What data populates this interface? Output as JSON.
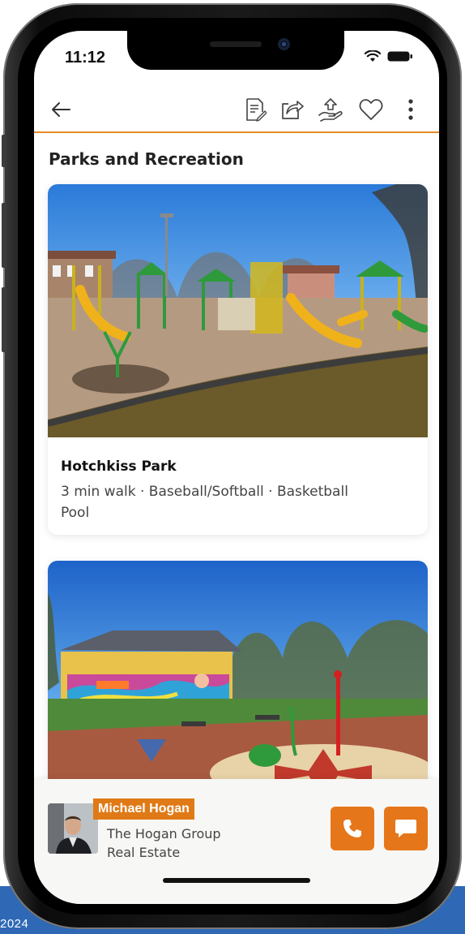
{
  "status_bar": {
    "time": "11:12"
  },
  "header": {
    "back_icon": "arrow-left-icon",
    "actions": [
      "document-edit-icon",
      "share-icon",
      "hand-offer-icon",
      "heart-icon",
      "more-vertical-icon"
    ]
  },
  "section": {
    "title": "Parks and Recreation"
  },
  "cards": [
    {
      "name": "Hotchkiss Park",
      "meta_line1": "3 min walk · Baseball/Softball · Basketball",
      "meta_line2": "Pool",
      "image": "playground-photo"
    },
    {
      "image": "park-mural-photo"
    }
  ],
  "agent": {
    "name": "Michael Hogan",
    "company_line1": "The Hogan Group",
    "company_line2": "Real Estate",
    "call_icon": "phone-icon",
    "message_icon": "chat-icon"
  },
  "footer": {
    "year": "2024"
  },
  "colors": {
    "accent": "#e6761a",
    "band": "#2f69b6"
  }
}
